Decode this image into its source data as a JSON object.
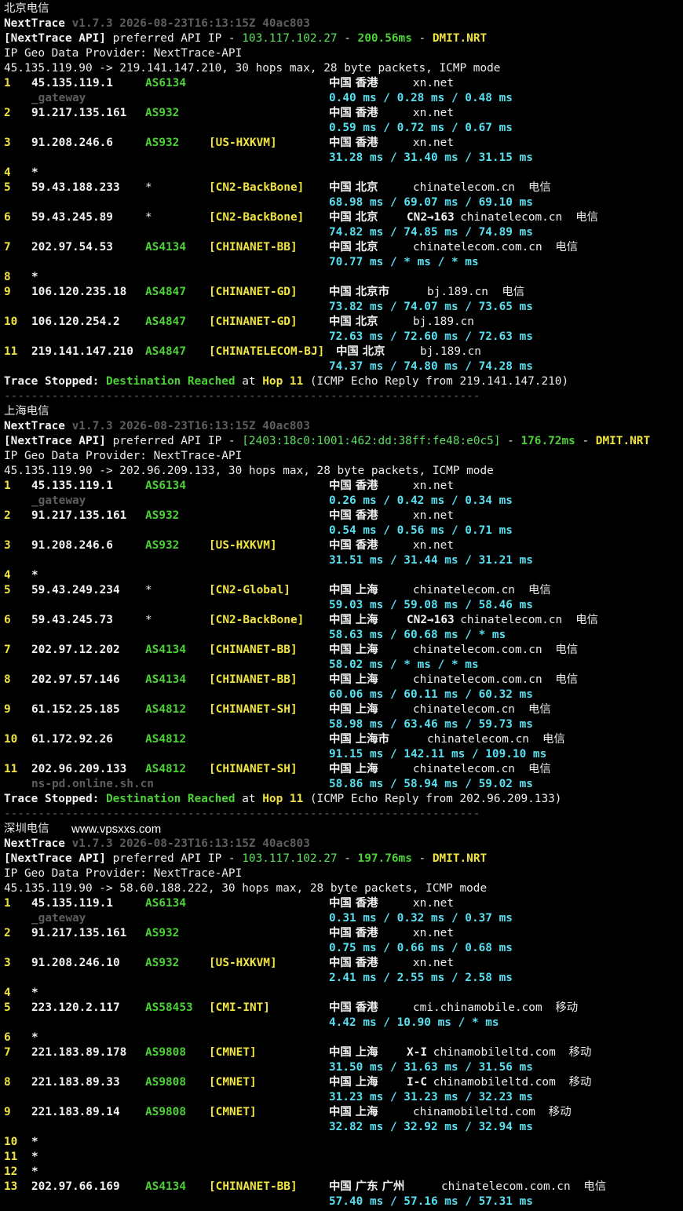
{
  "sections": [
    {
      "title": "北京电信",
      "watermark": "",
      "app": "NextTrace",
      "version": "v1.7.3 2026-08-23T16:13:15Z 40ac803",
      "api_tag": "[NextTrace API]",
      "api_text": " preferred API IP - ",
      "api_ip": "103.117.102.27",
      "api_dash1": " - ",
      "api_ms": "200.56ms",
      "api_dash2": " - ",
      "api_node": "DMIT.NRT",
      "geo_line": "IP Geo Data Provider: NextTrace-API",
      "route_line": "45.135.119.90 -> 219.141.147.210, 30 hops max, 28 byte packets, ICMP mode",
      "hops": [
        {
          "n": "1",
          "ip": "45.135.119.1",
          "as": "AS6134",
          "tag": "",
          "geo": "中国 香港",
          "sub": "",
          "dom": "xn.net",
          "isp": "",
          "rtt": "0.40 ms / 0.28 ms / 0.48 ms",
          "host": "_gateway"
        },
        {
          "n": "2",
          "ip": "91.217.135.161",
          "as": "AS932",
          "tag": "",
          "geo": "中国 香港",
          "sub": "",
          "dom": "xn.net",
          "isp": "",
          "rtt": "0.59 ms / 0.72 ms / 0.67 ms",
          "host": ""
        },
        {
          "n": "3",
          "ip": "91.208.246.6",
          "as": "AS932",
          "tag": "[US-HXKVM]",
          "geo": "中国 香港",
          "sub": "",
          "dom": "xn.net",
          "isp": "",
          "rtt": "31.28 ms / 31.40 ms / 31.15 ms",
          "host": ""
        },
        {
          "n": "4",
          "ip": "*",
          "as": "",
          "tag": "",
          "geo": "",
          "sub": "",
          "dom": "",
          "isp": "",
          "rtt": "",
          "host": ""
        },
        {
          "n": "5",
          "ip": "59.43.188.233",
          "as": "*",
          "tag": "[CN2-BackBone]",
          "geo": "中国 北京",
          "sub": "",
          "dom": "chinatelecom.cn",
          "isp": "电信",
          "rtt": "68.98 ms / 69.07 ms / 69.10 ms",
          "host": ""
        },
        {
          "n": "6",
          "ip": "59.43.245.89",
          "as": "*",
          "tag": "[CN2-BackBone]",
          "geo": "中国 北京",
          "sub": "CN2→163",
          "dom": "chinatelecom.cn",
          "isp": "电信",
          "rtt": "74.82 ms / 74.85 ms / 74.89 ms",
          "host": ""
        },
        {
          "n": "7",
          "ip": "202.97.54.53",
          "as": "AS4134",
          "tag": "[CHINANET-BB]",
          "geo": "中国 北京",
          "sub": "",
          "dom": "chinatelecom.com.cn",
          "isp": "电信",
          "rtt": "70.77 ms / * ms / * ms",
          "host": ""
        },
        {
          "n": "8",
          "ip": "*",
          "as": "",
          "tag": "",
          "geo": "",
          "sub": "",
          "dom": "",
          "isp": "",
          "rtt": "",
          "host": ""
        },
        {
          "n": "9",
          "ip": "106.120.235.18",
          "as": "AS4847",
          "tag": "[CHINANET-GD]",
          "geo": "中国 北京市",
          "sub": "",
          "dom": "bj.189.cn",
          "isp": "电信",
          "rtt": "73.82 ms / 74.07 ms / 73.65 ms",
          "host": ""
        },
        {
          "n": "10",
          "ip": "106.120.254.2",
          "as": "AS4847",
          "tag": "[CHINANET-GD]",
          "geo": "中国 北京",
          "sub": "",
          "dom": "bj.189.cn",
          "isp": "",
          "rtt": "72.63 ms / 72.60 ms / 72.63 ms",
          "host": ""
        },
        {
          "n": "11",
          "ip": "219.141.147.210",
          "as": "AS4847",
          "tag": "[CHINATELECOM-BJ]",
          "geo": "中国 北京",
          "sub": "",
          "dom": "bj.189.cn",
          "isp": "",
          "rtt": "74.37 ms / 74.80 ms / 74.28 ms",
          "host": "",
          "wide": true
        }
      ],
      "stop_label": "Trace Stopped:",
      "stop_dest": "Destination Reached",
      "stop_at": " at ",
      "stop_hop": "Hop 11",
      "stop_tail": " (ICMP Echo Reply from 219.141.147.210)",
      "separator": "----------------------------------------------------------------------"
    },
    {
      "title": "上海电信",
      "watermark": "",
      "app": "NextTrace",
      "version": "v1.7.3 2026-08-23T16:13:15Z 40ac803",
      "api_tag": "[NextTrace API]",
      "api_text": " preferred API IP - ",
      "api_ip": "[2403:18c0:1001:462:dd:38ff:fe48:e0c5]",
      "api_dash1": " - ",
      "api_ms": "176.72ms",
      "api_dash2": " - ",
      "api_node": "DMIT.NRT",
      "geo_line": "IP Geo Data Provider: NextTrace-API",
      "route_line": "45.135.119.90 -> 202.96.209.133, 30 hops max, 28 byte packets, ICMP mode",
      "hops": [
        {
          "n": "1",
          "ip": "45.135.119.1",
          "as": "AS6134",
          "tag": "",
          "geo": "中国 香港",
          "sub": "",
          "dom": "xn.net",
          "isp": "",
          "rtt": "0.26 ms / 0.42 ms / 0.34 ms",
          "host": "_gateway"
        },
        {
          "n": "2",
          "ip": "91.217.135.161",
          "as": "AS932",
          "tag": "",
          "geo": "中国 香港",
          "sub": "",
          "dom": "xn.net",
          "isp": "",
          "rtt": "0.54 ms / 0.56 ms / 0.71 ms",
          "host": ""
        },
        {
          "n": "3",
          "ip": "91.208.246.6",
          "as": "AS932",
          "tag": "[US-HXKVM]",
          "geo": "中国 香港",
          "sub": "",
          "dom": "xn.net",
          "isp": "",
          "rtt": "31.51 ms / 31.44 ms / 31.21 ms",
          "host": ""
        },
        {
          "n": "4",
          "ip": "*",
          "as": "",
          "tag": "",
          "geo": "",
          "sub": "",
          "dom": "",
          "isp": "",
          "rtt": "",
          "host": ""
        },
        {
          "n": "5",
          "ip": "59.43.249.234",
          "as": "*",
          "tag": "[CN2-Global]",
          "geo": "中国 上海",
          "sub": "",
          "dom": "chinatelecom.cn",
          "isp": "电信",
          "rtt": "59.03 ms / 59.08 ms / 58.46 ms",
          "host": ""
        },
        {
          "n": "6",
          "ip": "59.43.245.73",
          "as": "*",
          "tag": "[CN2-BackBone]",
          "geo": "中国 上海",
          "sub": "CN2→163",
          "dom": "chinatelecom.cn",
          "isp": "电信",
          "rtt": "58.63 ms / 60.68 ms / * ms",
          "host": ""
        },
        {
          "n": "7",
          "ip": "202.97.12.202",
          "as": "AS4134",
          "tag": "[CHINANET-BB]",
          "geo": "中国 上海",
          "sub": "",
          "dom": "chinatelecom.com.cn",
          "isp": "电信",
          "rtt": "58.02 ms / * ms / * ms",
          "host": ""
        },
        {
          "n": "8",
          "ip": "202.97.57.146",
          "as": "AS4134",
          "tag": "[CHINANET-BB]",
          "geo": "中国 上海",
          "sub": "",
          "dom": "chinatelecom.com.cn",
          "isp": "电信",
          "rtt": "60.06 ms / 60.11 ms / 60.32 ms",
          "host": ""
        },
        {
          "n": "9",
          "ip": "61.152.25.185",
          "as": "AS4812",
          "tag": "[CHINANET-SH]",
          "geo": "中国 上海",
          "sub": "",
          "dom": "chinatelecom.cn",
          "isp": "电信",
          "rtt": "58.98 ms / 63.46 ms / 59.73 ms",
          "host": ""
        },
        {
          "n": "10",
          "ip": "61.172.92.26",
          "as": "AS4812",
          "tag": "",
          "geo": "中国 上海市",
          "sub": "",
          "dom": "chinatelecom.cn",
          "isp": "电信",
          "rtt": "91.15 ms / 142.11 ms / 109.10 ms",
          "host": ""
        },
        {
          "n": "11",
          "ip": "202.96.209.133",
          "as": "AS4812",
          "tag": "[CHINANET-SH]",
          "geo": "中国 上海",
          "sub": "",
          "dom": "chinatelecom.cn",
          "isp": "电信",
          "rtt": "58.86 ms / 58.94 ms / 59.02 ms",
          "host": "ns-pd.online.sh.cn"
        }
      ],
      "stop_label": "Trace Stopped:",
      "stop_dest": "Destination Reached",
      "stop_at": " at ",
      "stop_hop": "Hop 11",
      "stop_tail": " (ICMP Echo Reply from 202.96.209.133)",
      "separator": "----------------------------------------------------------------------"
    },
    {
      "title": "深圳电信",
      "watermark": "www.vpsxxs.com",
      "app": "NextTrace",
      "version": "v1.7.3 2026-08-23T16:13:15Z 40ac803",
      "api_tag": "[NextTrace API]",
      "api_text": " preferred API IP - ",
      "api_ip": "103.117.102.27",
      "api_dash1": " - ",
      "api_ms": "197.76ms",
      "api_dash2": " - ",
      "api_node": "DMIT.NRT",
      "geo_line": "IP Geo Data Provider: NextTrace-API",
      "route_line": "45.135.119.90 -> 58.60.188.222, 30 hops max, 28 byte packets, ICMP mode",
      "hops": [
        {
          "n": "1",
          "ip": "45.135.119.1",
          "as": "AS6134",
          "tag": "",
          "geo": "中国 香港",
          "sub": "",
          "dom": "xn.net",
          "isp": "",
          "rtt": "0.31 ms / 0.32 ms / 0.37 ms",
          "host": "_gateway"
        },
        {
          "n": "2",
          "ip": "91.217.135.161",
          "as": "AS932",
          "tag": "",
          "geo": "中国 香港",
          "sub": "",
          "dom": "xn.net",
          "isp": "",
          "rtt": "0.75 ms / 0.66 ms / 0.68 ms",
          "host": ""
        },
        {
          "n": "3",
          "ip": "91.208.246.10",
          "as": "AS932",
          "tag": "[US-HXKVM]",
          "geo": "中国 香港",
          "sub": "",
          "dom": "xn.net",
          "isp": "",
          "rtt": "2.41 ms / 2.55 ms / 2.58 ms",
          "host": ""
        },
        {
          "n": "4",
          "ip": "*",
          "as": "",
          "tag": "",
          "geo": "",
          "sub": "",
          "dom": "",
          "isp": "",
          "rtt": "",
          "host": ""
        },
        {
          "n": "5",
          "ip": "223.120.2.117",
          "as": "AS58453",
          "tag": "[CMI-INT]",
          "geo": "中国 香港",
          "sub": "",
          "dom": "cmi.chinamobile.com",
          "isp": "移动",
          "rtt": "4.42 ms / 10.90 ms / * ms",
          "host": ""
        },
        {
          "n": "6",
          "ip": "*",
          "as": "",
          "tag": "",
          "geo": "",
          "sub": "",
          "dom": "",
          "isp": "",
          "rtt": "",
          "host": ""
        },
        {
          "n": "7",
          "ip": "221.183.89.178",
          "as": "AS9808",
          "tag": "[CMNET]",
          "geo": "中国 上海",
          "sub": "X-I",
          "dom": "chinamobileltd.com",
          "isp": "移动",
          "rtt": "31.50 ms / 31.63 ms / 31.56 ms",
          "host": ""
        },
        {
          "n": "8",
          "ip": "221.183.89.33",
          "as": "AS9808",
          "tag": "[CMNET]",
          "geo": "中国 上海",
          "sub": "I-C",
          "dom": "chinamobileltd.com",
          "isp": "移动",
          "rtt": "31.23 ms / 31.23 ms / 32.23 ms",
          "host": ""
        },
        {
          "n": "9",
          "ip": "221.183.89.14",
          "as": "AS9808",
          "tag": "[CMNET]",
          "geo": "中国 上海",
          "sub": "",
          "dom": "chinamobileltd.com",
          "isp": "移动",
          "rtt": "32.82 ms / 32.92 ms / 32.94 ms",
          "host": ""
        },
        {
          "n": "10",
          "ip": "*",
          "as": "",
          "tag": "",
          "geo": "",
          "sub": "",
          "dom": "",
          "isp": "",
          "rtt": "",
          "host": ""
        },
        {
          "n": "11",
          "ip": "*",
          "as": "",
          "tag": "",
          "geo": "",
          "sub": "",
          "dom": "",
          "isp": "",
          "rtt": "",
          "host": ""
        },
        {
          "n": "12",
          "ip": "*",
          "as": "",
          "tag": "",
          "geo": "",
          "sub": "",
          "dom": "",
          "isp": "",
          "rtt": "",
          "host": ""
        },
        {
          "n": "13",
          "ip": "202.97.66.169",
          "as": "AS4134",
          "tag": "[CHINANET-BB]",
          "geo": "中国 广东 广州",
          "sub": "",
          "dom": "chinatelecom.com.cn",
          "isp": "电信",
          "rtt": "57.40 ms / 57.16 ms / 57.31 ms",
          "host": ""
        }
      ],
      "stop_label": "",
      "stop_dest": "",
      "stop_at": "",
      "stop_hop": "",
      "stop_tail": "",
      "separator": ""
    }
  ]
}
